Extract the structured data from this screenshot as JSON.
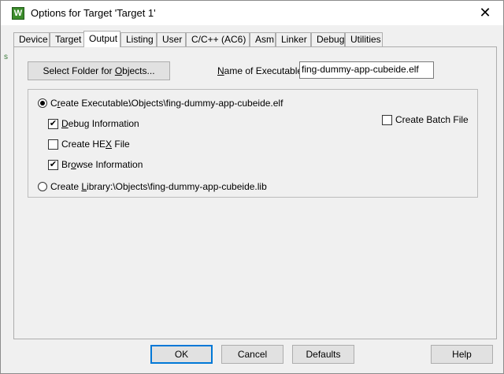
{
  "window": {
    "title": "Options for Target 'Target 1'",
    "app_icon_letter": "W",
    "close_glyph": "✕"
  },
  "stray_mark": "s",
  "tabs": [
    {
      "label": "Device",
      "active": false
    },
    {
      "label": "Target",
      "active": false
    },
    {
      "label": "Output",
      "active": true
    },
    {
      "label": "Listing",
      "active": false
    },
    {
      "label": "User",
      "active": false
    },
    {
      "label": "C/C++ (AC6)",
      "active": false
    },
    {
      "label": "Asm",
      "active": false
    },
    {
      "label": "Linker",
      "active": false
    },
    {
      "label": "Debug",
      "active": false
    },
    {
      "label": "Utilities",
      "active": false
    }
  ],
  "output": {
    "select_folder": {
      "before": "Select Folder for ",
      "underlined": "O",
      "after": "bjects..."
    },
    "name_of_executable": {
      "underlined": "N",
      "after": "ame of Executable:"
    },
    "executable_value": "fing-dummy-app-cubeide.elf",
    "create_executable": {
      "before": "C",
      "underlined": "r",
      "after": "eate Executable:",
      "path": ".\\Objects\\fing-dummy-app-cubeide.elf",
      "selected": true
    },
    "debug_information": {
      "underlined": "D",
      "after": "ebug Information",
      "checked": true
    },
    "create_hex_file": {
      "before": "Create HE",
      "underlined": "X",
      "after": " File",
      "checked": false
    },
    "browse_information": {
      "before": "Br",
      "underlined": "o",
      "after": "wse Information",
      "checked": true
    },
    "create_batch_file": {
      "before": "Create Batch File",
      "checked": false
    },
    "create_library": {
      "before": "Create ",
      "underlined": "L",
      "after": "ibrary:",
      "path": ".\\Objects\\fing-dummy-app-cubeide.lib",
      "selected": false
    }
  },
  "footer": {
    "ok": "OK",
    "cancel": "Cancel",
    "defaults": "Defaults",
    "help": "Help"
  },
  "glyphs": {
    "check": "✔"
  }
}
